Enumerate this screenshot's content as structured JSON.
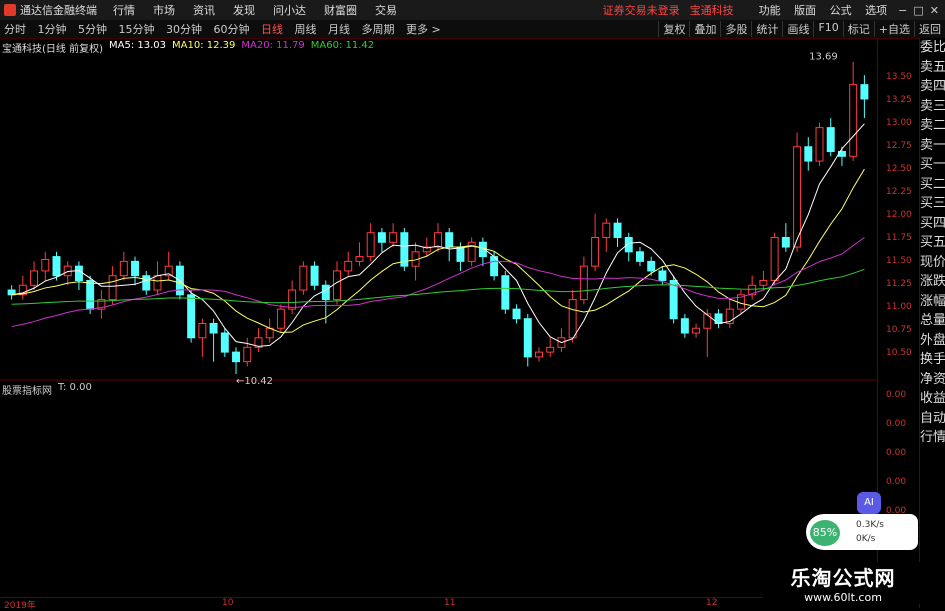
{
  "app": {
    "title": "通达信金融终端"
  },
  "menu": [
    "行情",
    "市场",
    "资讯",
    "发现",
    "问小达",
    "财富圈",
    "交易"
  ],
  "notice": "证券交易未登录",
  "stock_name": "宝通科技",
  "right_menu": [
    "功能",
    "版面",
    "公式",
    "选项"
  ],
  "window": {
    "min": "−",
    "max": "□",
    "close": "✕"
  },
  "periods": [
    "分时",
    "1分钟",
    "5分钟",
    "15分钟",
    "30分钟",
    "60分钟",
    "日线",
    "周线",
    "月线",
    "多周期",
    "更多 >"
  ],
  "active_period": "日线",
  "tools": [
    "复权",
    "叠加",
    "多股",
    "统计",
    "画线",
    "F10",
    "标记",
    "+自选",
    "返回"
  ],
  "legend": {
    "title": "宝通科技(日线 前复权)",
    "ma5": "MA5: 13.03",
    "ma10": "MA10: 12.39",
    "ma20": "MA20: 11.79",
    "ma60": "MA60: 11.42"
  },
  "indicator": {
    "name": "股票指标网",
    "value": "T: 0.00"
  },
  "sidebar": [
    "委比",
    "卖五",
    "卖四",
    "卖三",
    "卖二",
    "卖一",
    "买一",
    "买二",
    "买三",
    "买四",
    "买五",
    "现价",
    "涨跌",
    "涨幅",
    "总量",
    "外盘",
    "换手",
    "净资",
    "收益",
    "自动",
    "行情"
  ],
  "price_axis": [
    "13.50",
    "13.25",
    "13.00",
    "12.75",
    "12.50",
    "12.25",
    "12.00",
    "11.75",
    "11.50",
    "11.25",
    "11.00",
    "10.75",
    "10.50"
  ],
  "ind_axis": [
    "0.00",
    "0.00",
    "0.00",
    "0.00",
    "0.00"
  ],
  "time_labels": [
    "2019年",
    "10",
    "11",
    "12"
  ],
  "annotations": {
    "high": "13.69",
    "low": "10.42"
  },
  "speed": {
    "pct": "85%",
    "up": "0.3K/s",
    "down": "0K/s"
  },
  "ai_label": "AI",
  "watermark": {
    "line1": "乐淘公式网",
    "line2": "www.60lt.com"
  },
  "colors": {
    "up": "#ff3c3c",
    "down": "#54ffff",
    "ma5": "#ffffff",
    "ma10": "#ffff66",
    "ma20": "#cc33cc",
    "ma60": "#33cc33"
  },
  "chart_data": {
    "type": "candlestick",
    "candles": [
      [
        11.3,
        11.25,
        11.35,
        11.2
      ],
      [
        11.25,
        11.35,
        11.45,
        11.2
      ],
      [
        11.35,
        11.5,
        11.6,
        11.3
      ],
      [
        11.5,
        11.62,
        11.7,
        11.4
      ],
      [
        11.65,
        11.45,
        11.7,
        11.4
      ],
      [
        11.45,
        11.55,
        11.6,
        11.35
      ],
      [
        11.55,
        11.4,
        11.6,
        11.3
      ],
      [
        11.4,
        11.1,
        11.45,
        11.05
      ],
      [
        11.1,
        11.2,
        11.3,
        11.0
      ],
      [
        11.2,
        11.45,
        11.55,
        11.15
      ],
      [
        11.45,
        11.6,
        11.7,
        11.4
      ],
      [
        11.6,
        11.45,
        11.65,
        11.35
      ],
      [
        11.45,
        11.3,
        11.5,
        11.25
      ],
      [
        11.3,
        11.45,
        11.6,
        11.25
      ],
      [
        11.45,
        11.55,
        11.7,
        11.4
      ],
      [
        11.55,
        11.25,
        11.6,
        11.2
      ],
      [
        11.25,
        10.8,
        11.3,
        10.75
      ],
      [
        10.8,
        10.95,
        11.0,
        10.6
      ],
      [
        10.95,
        10.85,
        11.0,
        10.55
      ],
      [
        10.85,
        10.65,
        10.9,
        10.6
      ],
      [
        10.65,
        10.55,
        10.7,
        10.42
      ],
      [
        10.55,
        10.7,
        10.8,
        10.5
      ],
      [
        10.7,
        10.8,
        10.9,
        10.65
      ],
      [
        10.8,
        10.9,
        11.0,
        10.75
      ],
      [
        10.9,
        11.1,
        11.15,
        10.85
      ],
      [
        11.1,
        11.3,
        11.4,
        11.05
      ],
      [
        11.3,
        11.55,
        11.6,
        11.25
      ],
      [
        11.55,
        11.35,
        11.6,
        11.3
      ],
      [
        11.35,
        11.2,
        11.4,
        10.95
      ],
      [
        11.2,
        11.5,
        11.6,
        11.15
      ],
      [
        11.5,
        11.6,
        11.7,
        11.45
      ],
      [
        11.6,
        11.65,
        11.8,
        11.55
      ],
      [
        11.65,
        11.9,
        12.0,
        11.6
      ],
      [
        11.9,
        11.8,
        11.95,
        11.7
      ],
      [
        11.8,
        11.9,
        12.0,
        11.75
      ],
      [
        11.9,
        11.55,
        11.95,
        11.5
      ],
      [
        11.55,
        11.7,
        11.8,
        11.4
      ],
      [
        11.7,
        11.75,
        11.85,
        11.65
      ],
      [
        11.75,
        11.9,
        12.0,
        11.7
      ],
      [
        11.9,
        11.75,
        11.95,
        11.6
      ],
      [
        11.75,
        11.6,
        11.8,
        11.5
      ],
      [
        11.6,
        11.8,
        11.85,
        11.55
      ],
      [
        11.8,
        11.65,
        11.85,
        11.55
      ],
      [
        11.65,
        11.45,
        11.7,
        11.4
      ],
      [
        11.45,
        11.1,
        11.5,
        11.05
      ],
      [
        11.1,
        11.0,
        11.15,
        10.95
      ],
      [
        11.0,
        10.6,
        11.05,
        10.5
      ],
      [
        10.6,
        10.65,
        10.7,
        10.55
      ],
      [
        10.65,
        10.7,
        10.8,
        10.6
      ],
      [
        10.7,
        10.8,
        10.9,
        10.65
      ],
      [
        10.8,
        11.2,
        11.3,
        10.75
      ],
      [
        11.2,
        11.55,
        11.65,
        11.15
      ],
      [
        11.55,
        11.85,
        12.1,
        11.5
      ],
      [
        11.85,
        12.0,
        12.05,
        11.7
      ],
      [
        12.0,
        11.85,
        12.05,
        11.75
      ],
      [
        11.85,
        11.7,
        11.9,
        11.6
      ],
      [
        11.7,
        11.6,
        11.75,
        11.55
      ],
      [
        11.6,
        11.5,
        11.65,
        11.45
      ],
      [
        11.5,
        11.4,
        11.55,
        11.35
      ],
      [
        11.4,
        11.0,
        11.45,
        10.95
      ],
      [
        11.0,
        10.85,
        11.05,
        10.8
      ],
      [
        10.85,
        10.9,
        10.95,
        10.8
      ],
      [
        10.9,
        11.05,
        11.1,
        10.6
      ],
      [
        11.05,
        10.95,
        11.1,
        10.9
      ],
      [
        10.95,
        11.1,
        11.2,
        10.9
      ],
      [
        11.1,
        11.25,
        11.3,
        11.05
      ],
      [
        11.25,
        11.35,
        11.45,
        11.2
      ],
      [
        11.35,
        11.4,
        11.5,
        11.3
      ],
      [
        11.4,
        11.85,
        11.9,
        11.35
      ],
      [
        11.85,
        11.75,
        12.0,
        11.7
      ],
      [
        11.75,
        12.8,
        12.95,
        11.7
      ],
      [
        12.8,
        12.65,
        12.9,
        12.55
      ],
      [
        12.65,
        13.0,
        13.05,
        12.6
      ],
      [
        13.0,
        12.75,
        13.1,
        12.7
      ],
      [
        12.75,
        12.7,
        12.8,
        12.6
      ],
      [
        12.7,
        13.45,
        13.69,
        12.65
      ],
      [
        13.45,
        13.3,
        13.55,
        13.1
      ]
    ],
    "ylim": [
      10.4,
      13.75
    ],
    "ma5": "MA5: 13.03",
    "ma10": "MA10: 12.39",
    "ma20": "MA20: 11.79",
    "ma60": "MA60: 11.42"
  }
}
